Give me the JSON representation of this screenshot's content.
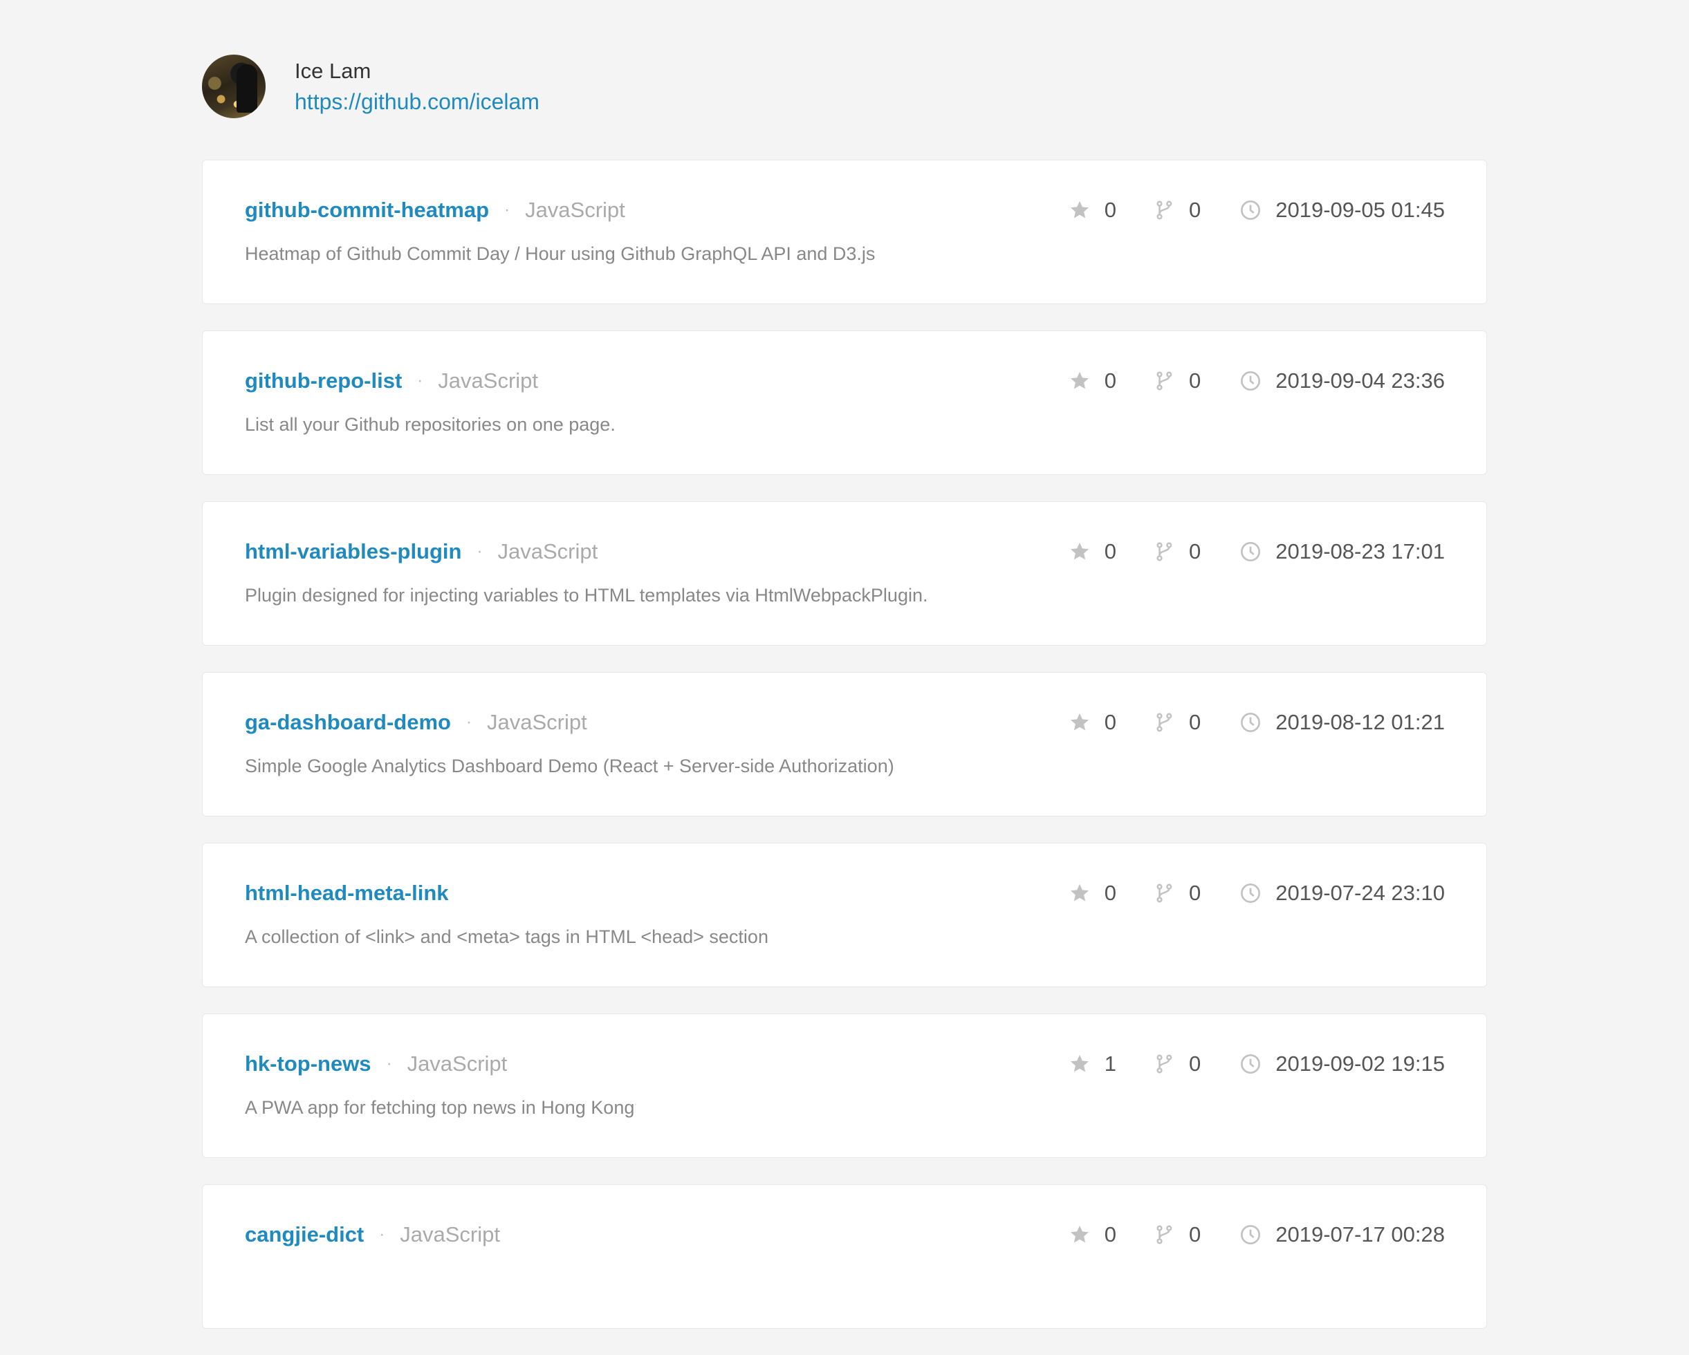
{
  "profile": {
    "name": "Ice Lam",
    "url": "https://github.com/icelam"
  },
  "repos": [
    {
      "name": "github-commit-heatmap",
      "language": "JavaScript",
      "description": "Heatmap of Github Commit Day / Hour using Github GraphQL API and D3.js",
      "stars": "0",
      "forks": "0",
      "updated": "2019-09-05 01:45"
    },
    {
      "name": "github-repo-list",
      "language": "JavaScript",
      "description": "List all your Github repositories on one page.",
      "stars": "0",
      "forks": "0",
      "updated": "2019-09-04 23:36"
    },
    {
      "name": "html-variables-plugin",
      "language": "JavaScript",
      "description": "Plugin designed for injecting variables to HTML templates via HtmlWebpackPlugin.",
      "stars": "0",
      "forks": "0",
      "updated": "2019-08-23 17:01"
    },
    {
      "name": "ga-dashboard-demo",
      "language": "JavaScript",
      "description": "Simple Google Analytics Dashboard Demo (React + Server-side Authorization)",
      "stars": "0",
      "forks": "0",
      "updated": "2019-08-12 01:21"
    },
    {
      "name": "html-head-meta-link",
      "language": "",
      "description": "A collection of <link> and <meta> tags in HTML <head> section",
      "stars": "0",
      "forks": "0",
      "updated": "2019-07-24 23:10"
    },
    {
      "name": "hk-top-news",
      "language": "JavaScript",
      "description": "A PWA app for fetching top news in Hong Kong",
      "stars": "1",
      "forks": "0",
      "updated": "2019-09-02 19:15"
    },
    {
      "name": "cangjie-dict",
      "language": "JavaScript",
      "description": "",
      "stars": "0",
      "forks": "0",
      "updated": "2019-07-17 00:28"
    }
  ],
  "icons": {
    "star": "star-icon",
    "fork": "fork-icon",
    "clock": "clock-icon"
  },
  "colors": {
    "link": "#1f8ac0",
    "background": "#f4f4f4",
    "card": "#ffffff",
    "muted": "#aaaaaa",
    "icon": "#c2c2c2"
  }
}
